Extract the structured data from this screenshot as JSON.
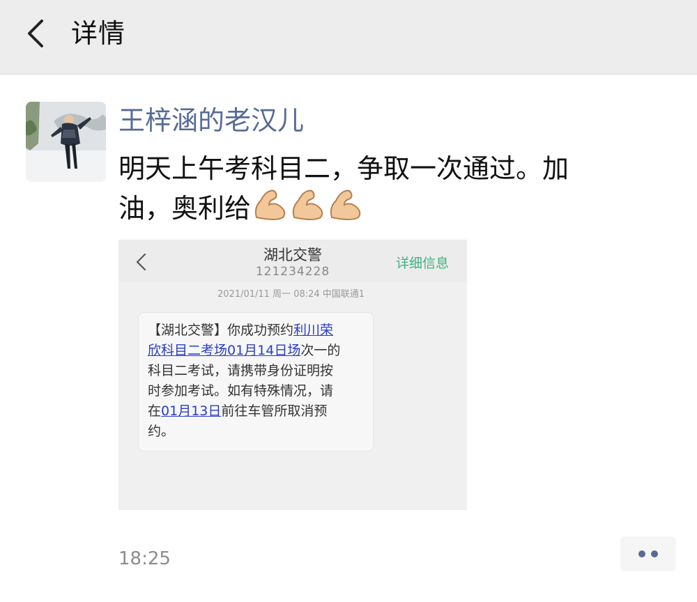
{
  "navbar": {
    "title": "详情",
    "back_icon": "chevron-left-icon"
  },
  "post": {
    "author": "王梓涵的老汉儿",
    "text_line1": "明天上午考科目二，争取一次通过。加",
    "text_line2": "油，奥利给",
    "emoji": "flexed-biceps",
    "emoji_count": 3,
    "time": "18:25",
    "more_icon": "more-dots-icon"
  },
  "screenshot": {
    "title": "湖北交警",
    "number": "121234228",
    "detail_link": "详细信息",
    "date": "2021/01/11 周一 08:24 中国联通1",
    "sms": {
      "l1_pre": "【湖北交警】你成功预约",
      "l1_link": "利川荣",
      "l2_link": "欣科目二考场01月14日场",
      "l2_post": "次一的",
      "l3": "科目二考试，请携带身份证明按",
      "l4": "时参加考试。如有特殊情况，请",
      "l5_pre": "在",
      "l5_link": "01月13日",
      "l5_post": "前往车管所取消预",
      "l6": "约。"
    },
    "accent_color": "#3fb27f",
    "link_color": "#2a3cc6"
  },
  "colors": {
    "author_blue": "#576b95",
    "navbar_bg": "#ededed"
  }
}
